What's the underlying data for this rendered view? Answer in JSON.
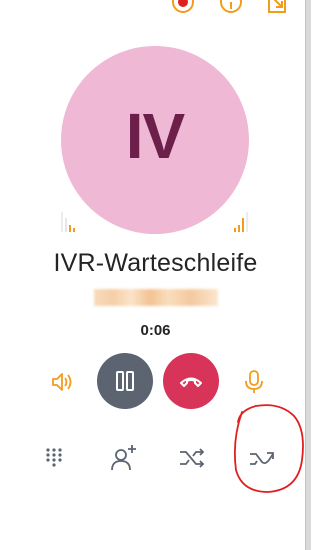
{
  "call": {
    "avatar_initials": "IV",
    "caller_name": "IVR-Warteschleife",
    "duration": "0:06"
  },
  "top_bar": {
    "icons": [
      "record-icon",
      "info-icon",
      "transfer-window-icon"
    ]
  },
  "controls": {
    "row1": [
      "speaker-icon",
      "pause-icon",
      "hangup-icon",
      "microphone-icon"
    ],
    "row2": [
      "dialpad-icon",
      "add-participant-icon",
      "shuffle-transfer-icon",
      "forward-transfer-icon"
    ]
  },
  "colors": {
    "accent_orange": "#f39b1b",
    "avatar_bg": "#efb8d4",
    "avatar_text": "#6b1f4a",
    "hold_button": "#5b6470",
    "hangup_button": "#d8345a",
    "annotation_red": "#e02020"
  }
}
